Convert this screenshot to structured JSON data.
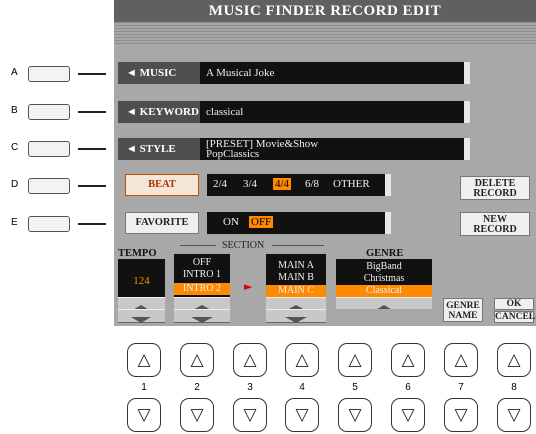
{
  "screen": {
    "title": "MUSIC FINDER RECORD EDIT",
    "music": {
      "label": "◄ MUSIC",
      "value": "A Musical Joke"
    },
    "keyword": {
      "label": "◄ KEYWORD",
      "value": "classical"
    },
    "style": {
      "label": "◄ STYLE",
      "value_line1": "[PRESET]   Movie&Show",
      "value_line2": "PopClassics"
    },
    "beat": {
      "label": "BEAT",
      "options": [
        "2/4",
        "3/4",
        "4/4",
        "6/8",
        "OTHER"
      ],
      "selected": "4/4"
    },
    "favorite": {
      "label": "FAVORITE",
      "options": [
        "ON",
        "OFF"
      ],
      "selected": "OFF"
    },
    "delete_record": {
      "line1": "DELETE",
      "line2": "RECORD"
    },
    "new_record": {
      "line1": "NEW",
      "line2": "RECORD"
    },
    "tempo": {
      "label": "TEMPO",
      "value": "124"
    },
    "section": {
      "label": "SECTION",
      "intro_items": [
        "OFF",
        "INTRO 1",
        "INTRO 2"
      ],
      "intro_selected": "INTRO 2",
      "main_items": [
        "MAIN A",
        "MAIN B",
        "MAIN C"
      ],
      "main_selected": "MAIN C"
    },
    "genre": {
      "label": "GENRE",
      "items": [
        "BigBand",
        "Christmas",
        "Classical"
      ],
      "selected": "Classical"
    },
    "genre_name": {
      "line1": "GENRE",
      "line2": "NAME"
    },
    "ok_cancel": {
      "ok": "OK",
      "cancel": "CANCEL"
    }
  },
  "side_buttons": [
    "A",
    "B",
    "C",
    "D",
    "E"
  ],
  "panel_buttons": [
    "1",
    "2",
    "3",
    "4",
    "5",
    "6",
    "7",
    "8"
  ],
  "glyphs": {
    "up": "△",
    "down": "▽",
    "arrow": "►"
  },
  "colors": {
    "accent": "#ff8a00",
    "label_red": "#b23000"
  }
}
